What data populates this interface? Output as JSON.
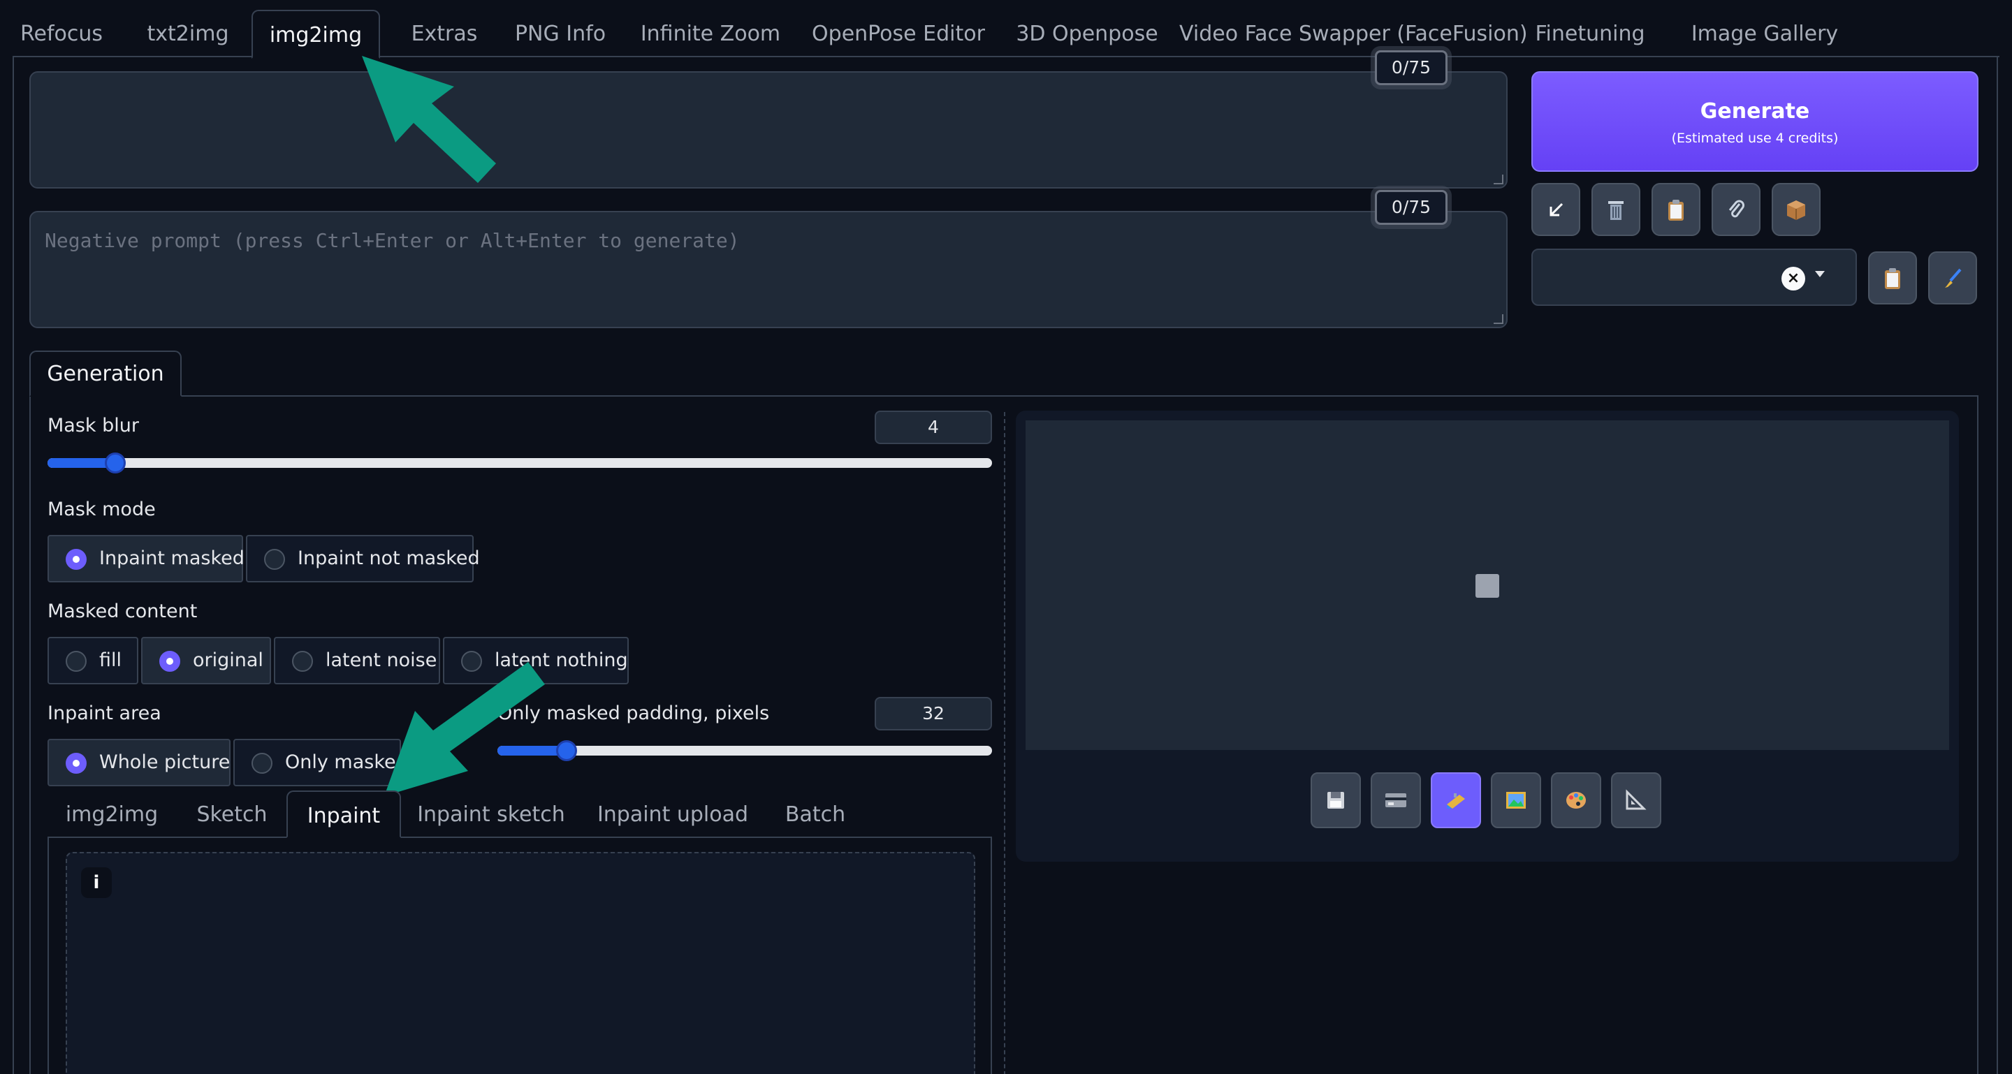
{
  "top_tabs": [
    "Refocus",
    "txt2img",
    "img2img",
    "Extras",
    "PNG Info",
    "Infinite Zoom",
    "OpenPose Editor",
    "3D Openpose",
    "Video Face Swapper (FaceFusion)",
    "Finetuning",
    "Image Gallery"
  ],
  "active_top_tab": "img2img",
  "prompt": {
    "value": "",
    "counter": "0/75"
  },
  "negative_prompt": {
    "placeholder": "Negative prompt (press Ctrl+Enter or Alt+Enter to generate)",
    "counter": "0/75"
  },
  "generate": {
    "label": "Generate",
    "sublabel": "(Estimated use 4 credits)"
  },
  "tools": {
    "icons": [
      "arrow-down-left-icon",
      "trash-icon",
      "clipboard-icon",
      "paperclip-icon",
      "package-icon"
    ]
  },
  "style_select": {
    "value": ""
  },
  "style_tools": {
    "icons": [
      "clipboard-icon",
      "brush-icon"
    ]
  },
  "generation_tab": "Generation",
  "mask_blur": {
    "label": "Mask blur",
    "value": "4",
    "fraction": 0.07
  },
  "mask_mode": {
    "label": "Mask mode",
    "options": [
      "Inpaint masked",
      "Inpaint not masked"
    ],
    "selected": 0
  },
  "masked_content": {
    "label": "Masked content",
    "options": [
      "fill",
      "original",
      "latent noise",
      "latent nothing"
    ],
    "selected": 1
  },
  "inpaint_area": {
    "label": "Inpaint area",
    "options": [
      "Whole picture",
      "Only masked"
    ],
    "selected": 0
  },
  "padding": {
    "label": "Only masked padding, pixels",
    "value": "32",
    "fraction": 0.14
  },
  "sub_tabs": [
    "img2img",
    "Sketch",
    "Inpaint",
    "Inpaint sketch",
    "Inpaint upload",
    "Batch"
  ],
  "active_sub_tab": "Inpaint",
  "info_icon": "i",
  "output_buttons": {
    "icons": [
      "save-icon",
      "zip-icon",
      "send-to-img2img-icon",
      "send-to-inpaint-icon",
      "send-to-extras-icon",
      "ruler-icon"
    ]
  },
  "colors": {
    "accent": "#6d5dfc",
    "slider": "#2563eb",
    "arrow": "#0b9b82",
    "background": "#0b0f19"
  }
}
